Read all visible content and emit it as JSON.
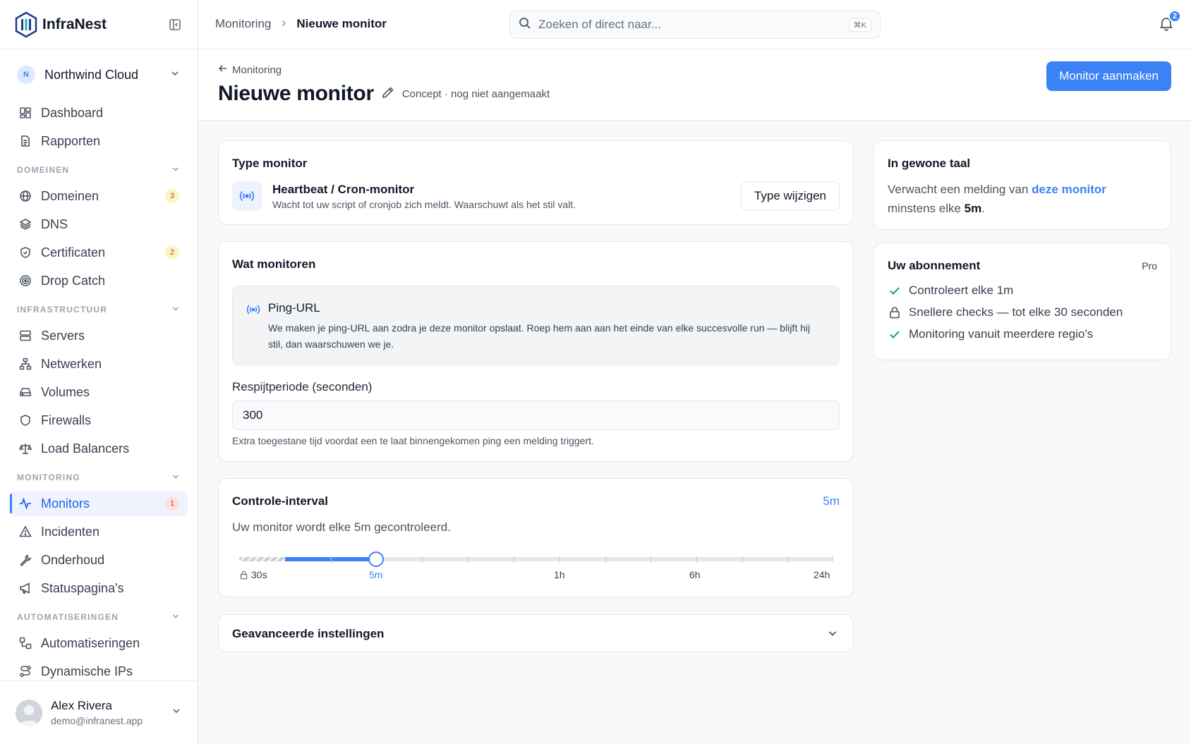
{
  "brand": {
    "name": "InfraNest"
  },
  "org": {
    "initial": "N",
    "name": "Northwind Cloud"
  },
  "nav": {
    "dashboard": "Dashboard",
    "reports": "Rapporten",
    "section_domains": "DOMEINEN",
    "domains": "Domeinen",
    "domains_badge": "3",
    "dns": "DNS",
    "certificates": "Certificaten",
    "certificates_badge": "2",
    "dropcatch": "Drop Catch",
    "section_infra": "INFRASTRUCTUUR",
    "servers": "Servers",
    "networks": "Netwerken",
    "volumes": "Volumes",
    "firewalls": "Firewalls",
    "loadbalancers": "Load Balancers",
    "section_monitoring": "MONITORING",
    "monitors": "Monitors",
    "monitors_badge": "1",
    "incidents": "Incidenten",
    "maintenance": "Onderhoud",
    "statuspages": "Statuspagina's",
    "section_automation": "AUTOMATISERINGEN",
    "automations": "Automatiseringen",
    "dynamicips": "Dynamische IPs"
  },
  "user": {
    "name": "Alex Rivera",
    "email": "demo@infranest.app"
  },
  "topbar": {
    "crumb_parent": "Monitoring",
    "crumb_current": "Nieuwe monitor",
    "search_placeholder": "Zoeken of direct naar...",
    "search_kbd": "⌘K",
    "notifications": "2"
  },
  "header": {
    "back": "Monitoring",
    "title": "Nieuwe monitor",
    "status": "Concept · nog niet aangemaakt",
    "create_button": "Monitor aanmaken"
  },
  "type_card": {
    "title": "Type monitor",
    "name": "Heartbeat / Cron-monitor",
    "description": "Wacht tot uw script of cronjob zich meldt. Waarschuwt als het stil valt.",
    "change_button": "Type wijzigen"
  },
  "what_card": {
    "title": "Wat monitoren",
    "ping_title": "Ping-URL",
    "ping_desc": "We maken je ping-URL aan zodra je deze monitor opslaat. Roep hem aan aan het einde van elke succesvolle run — blijft hij stil, dan waarschuwen we je.",
    "grace_label": "Respijtperiode (seconden)",
    "grace_value": "300",
    "grace_help": "Extra toegestane tijd voordat een te laat binnengekomen ping een melding triggert."
  },
  "interval_card": {
    "title": "Controle-interval",
    "value": "5m",
    "description": "Uw monitor wordt elke 5m gecontroleerd.",
    "labels": [
      "30s",
      "5m",
      "1h",
      "6h",
      "24h"
    ],
    "selected": "5m"
  },
  "advanced": {
    "title": "Geavanceerde instellingen"
  },
  "plain": {
    "title": "In gewone taal",
    "text_before": "Verwacht een melding van ",
    "link": "deze monitor",
    "text_middle": " minstens elke ",
    "bold": "5m",
    "text_after": "."
  },
  "plan": {
    "title": "Uw abonnement",
    "tier": "Pro",
    "items": [
      {
        "text": "Controleert elke 1m",
        "icon": "check-icon"
      },
      {
        "text": "Snellere checks — tot elke 30 seconden",
        "icon": "lock-icon"
      },
      {
        "text": "Monitoring vanuit meerdere regio's",
        "icon": "check-icon"
      }
    ]
  },
  "colors": {
    "accent": "#3b82f6",
    "success": "#16a34a",
    "amber": "#b45309",
    "danger": "#dc2626"
  }
}
